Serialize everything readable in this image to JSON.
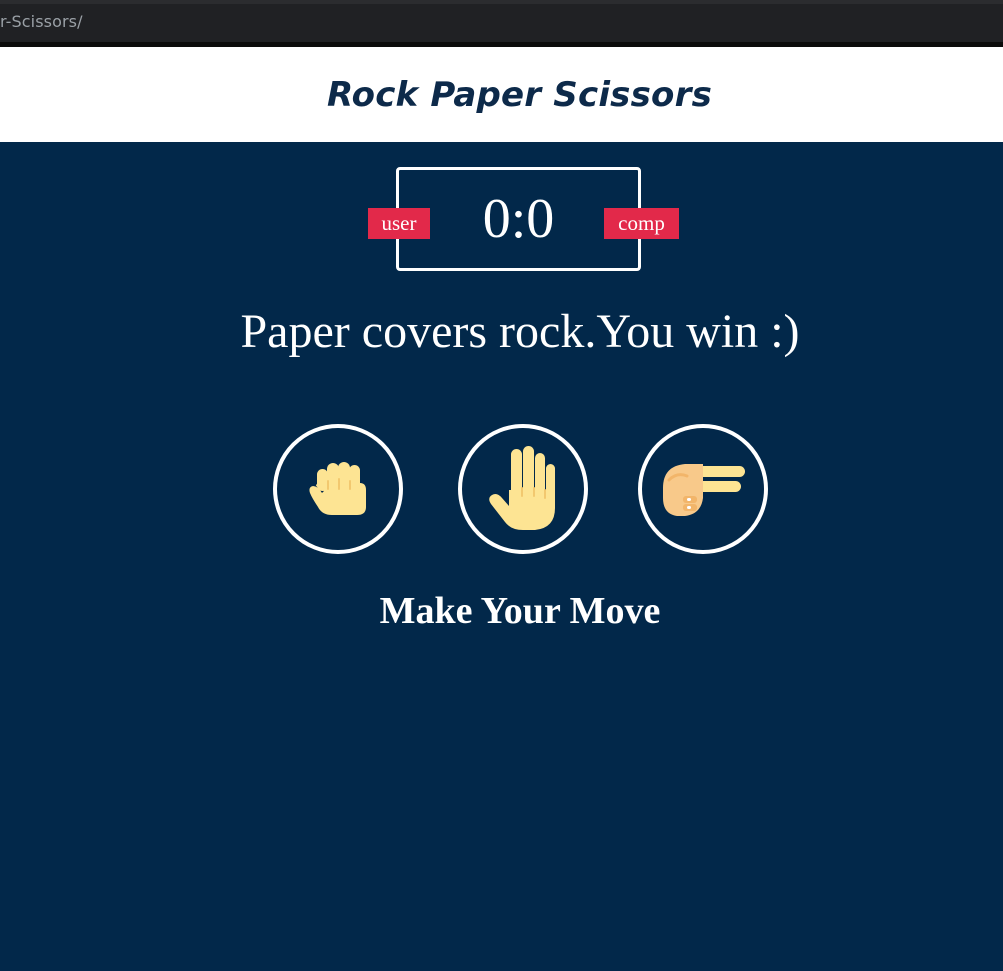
{
  "browser": {
    "url_fragment": "r-Scissors/"
  },
  "header": {
    "title": "Rock Paper Scissors"
  },
  "scoreboard": {
    "user_label": "user",
    "comp_label": "comp",
    "score": "0:0"
  },
  "result": {
    "message": "Paper covers rock.You win :)"
  },
  "choices": [
    {
      "id": "rock",
      "icon": "fist-icon"
    },
    {
      "id": "paper",
      "icon": "raised-hand-icon"
    },
    {
      "id": "scissors",
      "icon": "victory-hand-icon"
    }
  ],
  "action": {
    "message": "Make Your Move"
  },
  "colors": {
    "background": "#02284a",
    "header_bg": "#ffffff",
    "title": "#0d2a4a",
    "badge": "#e2294a",
    "hand_fill": "#fde493",
    "hand_shadow": "#f2c86f"
  }
}
